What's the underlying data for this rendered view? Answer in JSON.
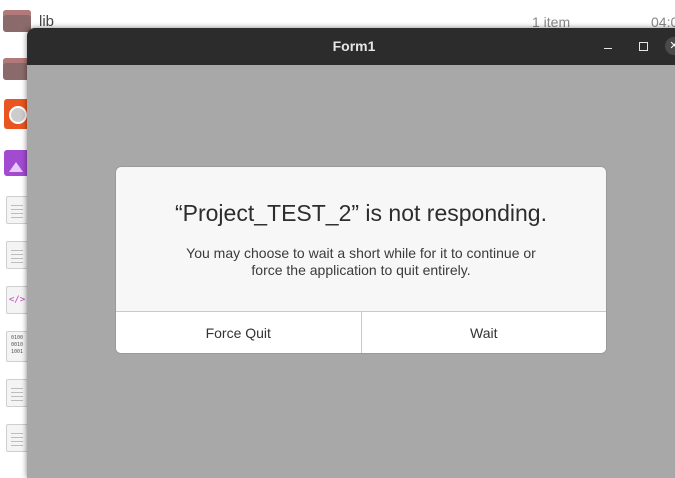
{
  "background": {
    "first_row_name": "lib",
    "first_row_count": "1 item",
    "first_row_time": "04:0"
  },
  "window": {
    "title": "Form1",
    "minimize_icon": "minimize-icon",
    "maximize_icon": "maximize-icon",
    "close_icon": "close-icon"
  },
  "dialog": {
    "title": "“Project_TEST_2” is not responding.",
    "message_line1": "You may choose to wait a short while for it to continue or",
    "message_line2": "force the application to quit entirely.",
    "force_quit_label": "Force Quit",
    "wait_label": "Wait"
  },
  "colors": {
    "titlebar": "#2c2c2c",
    "window_body": "#a8a8a8",
    "dialog_bg": "#f7f7f7"
  }
}
